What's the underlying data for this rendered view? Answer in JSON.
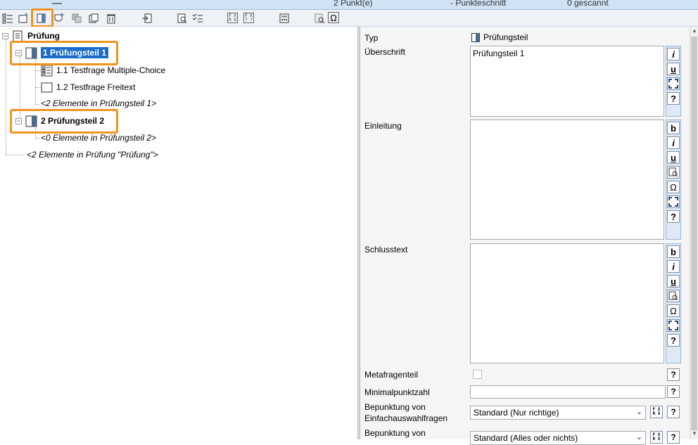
{
  "statusbar": {
    "points": "2 Punkt(e)",
    "average": "- Punkteschnitt",
    "scanned": "0 gescannt"
  },
  "toolbar": {
    "buttons": [
      "add-question-icon",
      "add-exam-part-icon",
      "add-section-icon",
      "move-icon",
      "copy-icon",
      "duplicate-icon",
      "delete-icon",
      "import-icon",
      "preview-icon",
      "checklist-icon",
      "formula-icon",
      "formula-template-icon",
      "calculator-icon",
      "search-page-icon",
      "omega-icon"
    ],
    "formula_top": "F X",
    "formula_bottom": "R X",
    "formula2_top": "F X",
    "formula2_bottom": "? ?",
    "omega": "Ω"
  },
  "tree": {
    "root": {
      "label": "Prüfung",
      "expander": "−"
    },
    "parts": [
      {
        "label": "1 Prüfungsteil 1",
        "expander": "−",
        "selected": true,
        "children": [
          {
            "label": "1.1 Testfrage Multiple-Choice",
            "icon": "multiple-choice-icon"
          },
          {
            "label": "1.2 Testfrage Freitext",
            "icon": "free-text-icon"
          }
        ],
        "summary": "<2 Elemente in Prüfungsteil 1>"
      },
      {
        "label": "2 Prüfungsteil 2",
        "expander": "−",
        "selected": false,
        "children": [],
        "summary": "<0 Elemente in Prüfungsteil 2>"
      }
    ],
    "summary": "<2 Elemente in Prüfung \"Prüfung\">"
  },
  "props": {
    "typ_label": "Typ",
    "typ_value": "Prüfungsteil",
    "ueberschrift_label": "Überschrift",
    "ueberschrift_value": "Prüfungsteil 1",
    "einleitung_label": "Einleitung",
    "einleitung_value": "",
    "schlusstext_label": "Schlusstext",
    "schlusstext_value": "",
    "metafragenteil_label": "Metafragenteil",
    "metafragenteil_checked": false,
    "minimalpunktzahl_label": "Minimalpunktzahl",
    "minimalpunktzahl_value": "",
    "bepunktung_einfach_label_1": "Bepunktung von",
    "bepunktung_einfach_label_2": "Einfachauswahlfragen",
    "bepunktung_einfach_value": "Standard (Nur richtige)",
    "bepunktung_mehrfach_label_1": "Bepunktung von",
    "bepunktung_mehrfach_value": "Standard (Alles oder nichts)",
    "rte_buttons": {
      "bold": "b",
      "italic": "i",
      "underline": "u",
      "omega": "Ω",
      "help": "?"
    }
  }
}
